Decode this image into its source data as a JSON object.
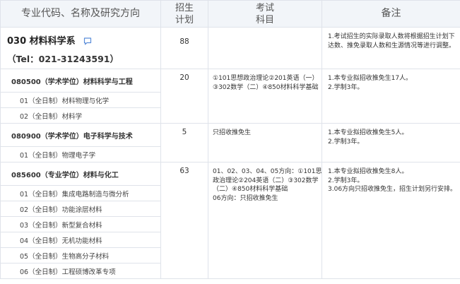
{
  "header": {
    "col1": "专业代码、名称及研究方向",
    "col2_line1": "招生",
    "col2_line2": "计划",
    "col3_line1": "考试",
    "col3_line2": "科目",
    "col4": "备注"
  },
  "department": {
    "name": "030 材料科学系",
    "tel": "（Tel：021-31243591）",
    "icon": "chat-bubble-icon",
    "quota": "88",
    "note": "1.考试招生的实际录取人数将根据招生计划下达数、推免录取人数和生源情况等进行调整。"
  },
  "majors": [
    {
      "title": "080500（学术学位）材料科学与工程",
      "quota": "20",
      "exam": [
        "①101思想政治理论②201英语（一）",
        "③302数学（二）④850材料科学基础"
      ],
      "notes": [
        "1.本专业拟招收推免生17人。",
        "2.学制3年。"
      ],
      "directions": [
        "01（全日制）材料物理与化学",
        "02（全日制）材料学"
      ]
    },
    {
      "title": "080900（学术学位）电子科学与技术",
      "quota": "5",
      "exam": [
        "只招收推免生"
      ],
      "notes": [
        "1.本专业拟招收推免生5人。",
        "2.学制3年。"
      ],
      "directions": [
        "01（全日制）物理电子学"
      ]
    },
    {
      "title": "085600（专业学位）材料与化工",
      "quota": "63",
      "exam": [
        "01、02、03、04、05方向：①101思想",
        "政治理论②204英语（二）③302数学",
        "（二）④850材料科学基础",
        "06方向：只招收推免生"
      ],
      "notes": [
        "1.本专业拟招收推免生8人。",
        "2.学制3年。",
        "3.06方向只招收推免生，招生计划另行安排。"
      ],
      "directions": [
        "01（全日制）集成电路制造与微分析",
        "02（全日制）功能涂层材料",
        "03（全日制）新型复合材料",
        "04（全日制）无机功能材料",
        "05（全日制）生物高分子材料",
        "06（全日制）工程硕博改革专项"
      ]
    }
  ]
}
